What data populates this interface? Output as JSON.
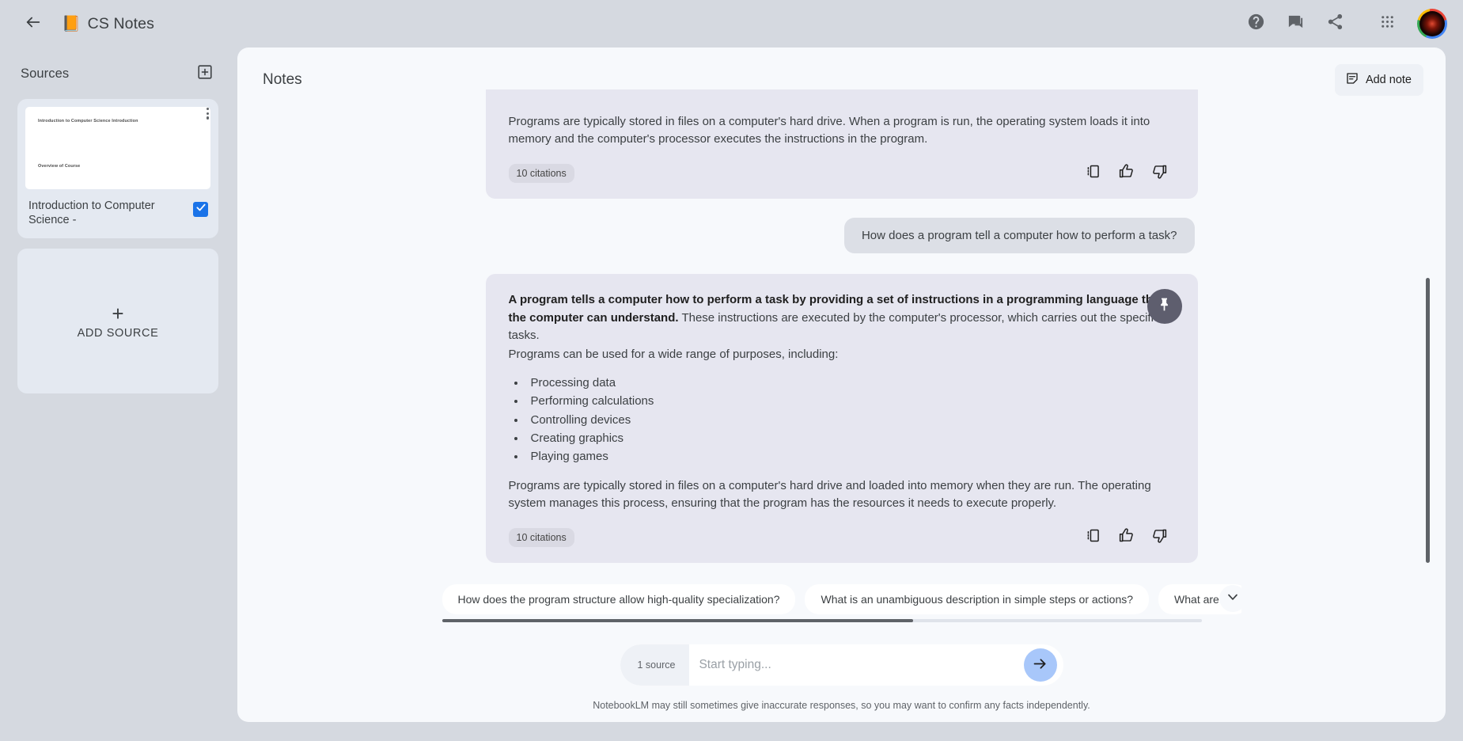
{
  "topbar": {
    "back_icon": "arrow-left-icon",
    "book_emoji": "📙",
    "title": "CS Notes",
    "help_icon": "help-circle-icon",
    "feedback_icon": "feedback-chat-icon",
    "share_icon": "share-icon",
    "apps_icon": "apps-grid-icon",
    "avatar_label": "avatar"
  },
  "sidebar": {
    "title": "Sources",
    "add_source_icon": "add-box-icon",
    "source": {
      "thumb_heading": "Introduction to Computer Science Introduction",
      "thumb_subheading": "Overview of Course",
      "name": "Introduction to Computer Science -",
      "selected": true,
      "kebab_icon": "more-vert-icon"
    },
    "add_source": {
      "plus": "+",
      "label": "ADD SOURCE"
    }
  },
  "main": {
    "title": "Notes",
    "add_note_label": "Add note",
    "add_note_icon": "note-add-icon",
    "messages": [
      {
        "role": "model",
        "clipped": true,
        "paragraph": "Programs are typically stored in files on a computer's hard drive. When a program is run, the operating system loads it into memory and the computer's processor executes the instructions in the program.",
        "citations_label": "10 citations",
        "actions": [
          "save-to-note-icon",
          "thumb-up-icon",
          "thumb-down-icon"
        ]
      },
      {
        "role": "user",
        "text": "How does a program tell a computer how to perform a task?"
      },
      {
        "role": "model",
        "lead_bold": "A program tells a computer how to perform a task by providing a set of instructions in a programming language that the computer can understand.",
        "lead_rest": " These instructions are executed by the computer's processor, which carries out the specified tasks.",
        "intro_line": "Programs can be used for a wide range of purposes, including:",
        "bullets": [
          "Processing data",
          "Performing calculations",
          "Controlling devices",
          "Creating graphics",
          "Playing games"
        ],
        "closing": "Programs are typically stored in files on a computer's hard drive and loaded into memory when they are run. The operating system manages this process, ensuring that the program has the resources it needs to execute properly.",
        "citations_label": "10 citations",
        "pin_icon": "pin-icon",
        "actions": [
          "save-to-note-icon",
          "thumb-up-icon",
          "thumb-down-icon"
        ]
      }
    ],
    "suggestion_chips": [
      "How does the program structure allow high-quality specialization?",
      "What is an unambiguous description in simple steps or actions?",
      "What are the cl"
    ],
    "chips_expand_icon": "chevron-down-icon",
    "composer": {
      "source_count": "1 source",
      "placeholder": "Start typing...",
      "value": "",
      "send_icon": "arrow-right-icon"
    },
    "disclaimer": "NotebookLM may still sometimes give inaccurate responses, so you may want to confirm any facts independently."
  },
  "colors": {
    "page_bg": "#d5d9e0",
    "panel_bg": "#f7f9fc",
    "model_bubble": "#e6e6f0",
    "user_bubble": "#dcdfe6",
    "accent_blue": "#1a73e8",
    "send_blue": "#a8c7fa",
    "pin_btn": "#5e5e6e"
  }
}
